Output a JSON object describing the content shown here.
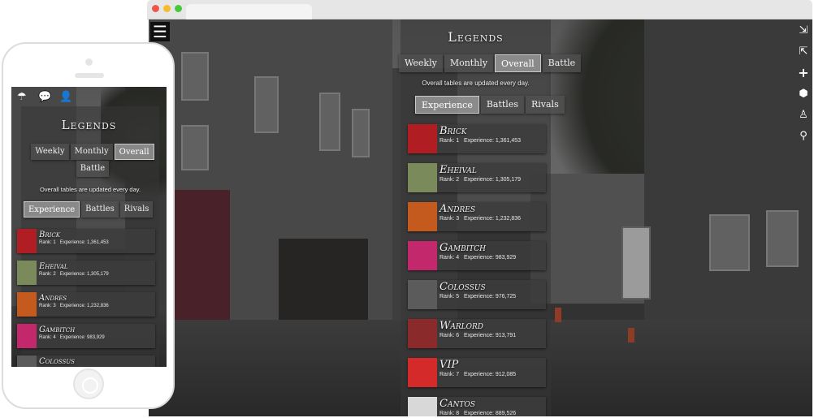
{
  "app": {
    "title": "Legends",
    "period_tabs": [
      {
        "label": "Weekly",
        "active": false
      },
      {
        "label": "Monthly",
        "active": false
      },
      {
        "label": "Overall",
        "active": true
      },
      {
        "label": "Battle",
        "active": false
      }
    ],
    "notice": "Overall tables are updated every day.",
    "category_tabs": [
      {
        "label": "Experience",
        "active": true
      },
      {
        "label": "Battles",
        "active": false
      },
      {
        "label": "Rivals",
        "active": false
      }
    ],
    "leaders": [
      {
        "name": "Brick",
        "rank": "Rank: 1",
        "exp": "Experience: 1,361,453",
        "avatar_color": "#b01e24"
      },
      {
        "name": "Eheival",
        "rank": "Rank: 2",
        "exp": "Experience: 1,305,179",
        "avatar_color": "#7a8a5a"
      },
      {
        "name": "Andres",
        "rank": "Rank: 3",
        "exp": "Experience: 1,232,836",
        "avatar_color": "#c45a1e"
      },
      {
        "name": "Gambitch",
        "rank": "Rank: 4",
        "exp": "Experience: 983,929",
        "avatar_color": "#c2286b"
      },
      {
        "name": "Colossus",
        "rank": "Rank: 5",
        "exp": "Experience: 976,725",
        "avatar_color": "#5b5b5b"
      },
      {
        "name": "Warlord",
        "rank": "Rank: 6",
        "exp": "Experience: 913,791",
        "avatar_color": "#8a2a2a"
      },
      {
        "name": "VIP",
        "rank": "Rank: 7",
        "exp": "Experience: 912,085",
        "avatar_color": "#d42a2a"
      },
      {
        "name": "Cantos",
        "rank": "Rank: 8",
        "exp": "Experience: 889,526",
        "avatar_color": "#d8d8d8"
      }
    ]
  },
  "desktop": {
    "menu_icon": "hamburger-icon",
    "side_icons": [
      "sign-out-icon",
      "sign-in-icon",
      "plus-icon",
      "shield-icon",
      "person-icon",
      "map-pin-icon"
    ]
  },
  "mobile": {
    "top_icons": [
      "umbrella-icon",
      "chat-icon",
      "user-icon"
    ]
  }
}
